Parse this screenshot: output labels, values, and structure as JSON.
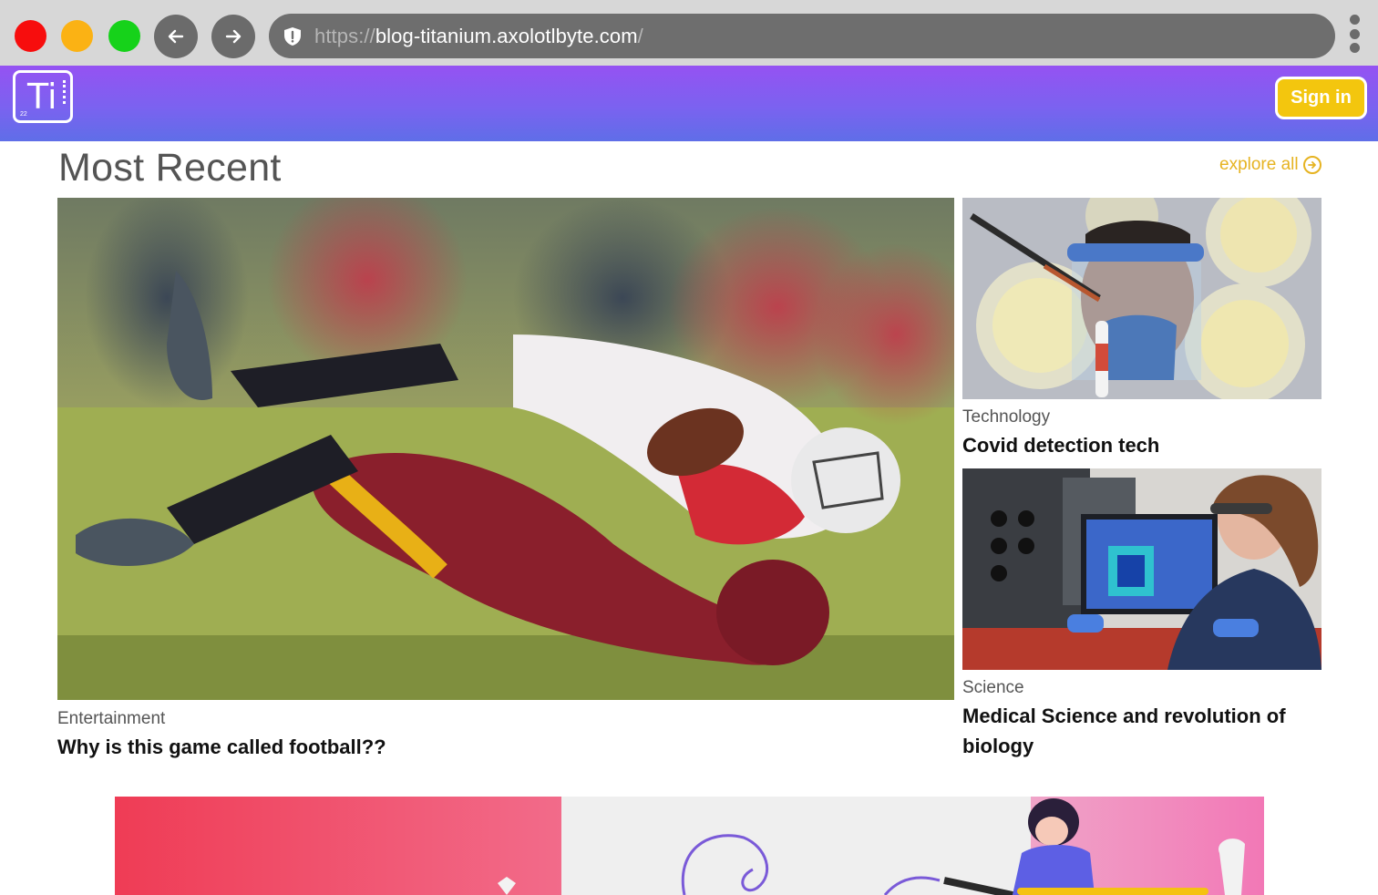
{
  "browser": {
    "url_protocol": "https://",
    "url_host": "blog-titanium.axolotlbyte.com",
    "url_path": "/",
    "icons": {
      "back": "arrow-left-icon",
      "forward": "arrow-right-icon",
      "security": "shield-icon",
      "menu": "kebab-menu-icon"
    },
    "colors": {
      "close": "#f70d0d",
      "minimize": "#fbb214",
      "maximize": "#16d21a"
    }
  },
  "header": {
    "logo_symbol": "Ti",
    "logo_number": "22",
    "signin_label": "Sign in",
    "colors": {
      "gradient_start": "#9552f2",
      "gradient_end": "#5f6ee8",
      "accent": "#f3c60e"
    }
  },
  "section": {
    "title": "Most Recent",
    "explore_label": "explore all"
  },
  "posts": [
    {
      "category": "Entertainment",
      "title": "Why is this game called football??",
      "image": "football-tackle-photo"
    },
    {
      "category": "Technology",
      "title": "Covid detection tech",
      "image": "lab-face-shield-photo"
    },
    {
      "category": "Science",
      "title": "Medical Science and revolution of biology",
      "image": "lab-scientist-photo"
    }
  ]
}
